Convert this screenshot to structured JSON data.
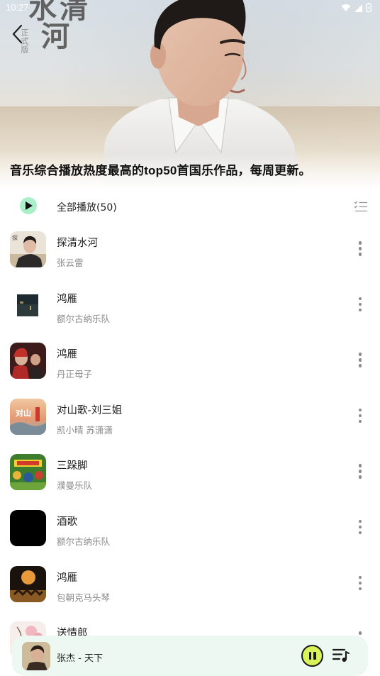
{
  "status_bar": {
    "time": "10:27"
  },
  "banner": {
    "calligraphy_line1": "水清",
    "calligraphy_line2": "河",
    "seal_text": "正式版",
    "description": "音乐综合播放热度最高的top50首国乐作品，每周更新。"
  },
  "play_all": {
    "label": "全部播放(50)"
  },
  "songs": [
    {
      "title": "探清水河",
      "artist": "张云雷"
    },
    {
      "title": "鸿雁",
      "artist": "额尔古纳乐队"
    },
    {
      "title": "鸿雁",
      "artist": "丹正母子"
    },
    {
      "title": "对山歌-刘三姐",
      "artist": "凯小晴 苏潇潇"
    },
    {
      "title": "三跺脚",
      "artist": "濮曼乐队"
    },
    {
      "title": "酒歌",
      "artist": "额尔古纳乐队"
    },
    {
      "title": "鸿雁",
      "artist": "包朝克马头琴"
    },
    {
      "title": "送情郎",
      "artist": ""
    }
  ],
  "mini_player": {
    "now_playing": "张杰 - 天下"
  },
  "colors": {
    "play_all_accent": "#a9f0c8",
    "mini_player_bg": "#ecf8f1",
    "pause_button": "#d8f25a"
  },
  "icons": {
    "back": "chevron-left-icon",
    "play_all": "play-icon",
    "multi_select": "list-check-icon",
    "more": "more-vertical-icon",
    "pause": "pause-icon",
    "playlist": "playlist-icon"
  }
}
